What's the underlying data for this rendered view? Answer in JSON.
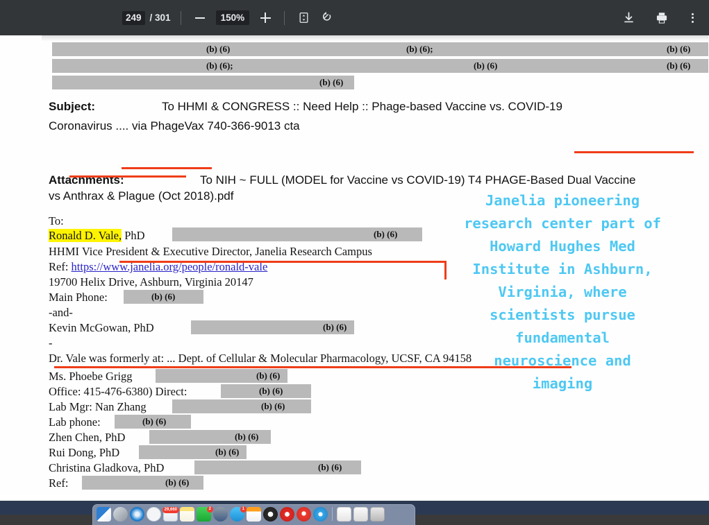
{
  "toolbar": {
    "current_page": "249",
    "page_total": "/ 301",
    "zoom_out_label": "zoom-out",
    "zoom_level": "150%",
    "zoom_in_label": "zoom-in",
    "fit_label": "fit-to-page",
    "rotate_label": "rotate",
    "download_label": "download",
    "print_label": "print",
    "more_label": "more-options"
  },
  "document": {
    "redactions": [
      {
        "label": "(b) (6)"
      },
      {
        "label": "(b) (6);"
      },
      {
        "label": "(b) (6)"
      },
      {
        "label": "(b) (6);"
      },
      {
        "label": "(b) (6)"
      },
      {
        "label": "(b) (6)"
      },
      {
        "label": "(b) (6)"
      }
    ],
    "subject_label": "Subject:",
    "subject_line1": "To HHMI & CONGRESS :: Need Help :: Phage-based Vaccine vs. COVID-19",
    "subject_line2_a": "Coronavirus .... via ",
    "subject_line2_b": "PhageVax 740-366-9013",
    "subject_line2_c": " cta",
    "attachments_label": "Attachments:",
    "attachments_line1_a": "To NIH ~ FULL (MODEL for Vaccine vs COVID-19) T4 PHAGE-",
    "attachments_line1_b": "Based Dual Vaccine",
    "attachments_line2_a": "vs Anthrax & Plague",
    "attachments_line2_b": " (Oct 2018).pdf",
    "to_label": "To:",
    "recipient_name": "Ronald D. Vale,",
    "recipient_degree": " PhD",
    "recipient_title": "HHMI Vice President & Executive Director, Janelia Research Campus",
    "ref_label": "Ref: ",
    "ref_url": "https://www.janelia.org/people/ronald-vale",
    "address": "19700 Helix Drive, Ashburn, Virginia 20147",
    "main_phone_label": "Main Phone:",
    "and_label": "-and-",
    "contact2_name": "Kevin McGowan, PhD",
    "dash_label": "-",
    "formerly_at": "Dr. Vale was formerly at: ... Dept. of Cellular & Molecular Pharmacology, UCSF, CA 94158",
    "contact3_name": "Ms. Phoebe Grigg",
    "office_line": "Office: 415-476-6380)  Direct:",
    "lab_mgr_line": "Lab Mgr: Nan Zhang",
    "lab_phone_label": "Lab phone:",
    "contact4_name": "Zhen Chen, PhD",
    "contact5_name": "Rui Dong, PhD",
    "contact6_name": "Christina Gladkova, PhD",
    "ref2_label": "Ref:",
    "redaction_tag": "(b) (6)"
  },
  "annotation": {
    "text": "Janelia pioneering\nresearch center part of\nHoward Hughes Med\nInstitute in Ashburn,\nVirginia, where\nscientists pursue\nfundamental\nneuroscience and\nimaging"
  },
  "colors": {
    "annotation_cyan": "#4ec8f2",
    "markup_red": "#ef3d19",
    "highlight_yellow": "#fff400",
    "link_blue": "#2a23c8",
    "redaction_gray": "#b9b9b9",
    "toolbar_bg": "#323639"
  },
  "dock": {
    "badge_mail": "29,660",
    "badge_messages": "2",
    "badge_facetime": "1"
  }
}
